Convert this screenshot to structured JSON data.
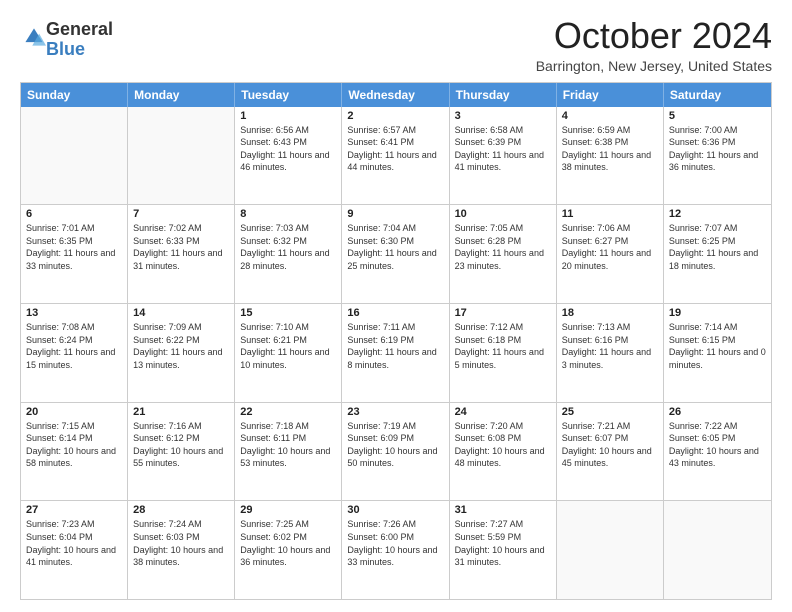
{
  "logo": {
    "general": "General",
    "blue": "Blue"
  },
  "title": "October 2024",
  "location": "Barrington, New Jersey, United States",
  "days": [
    "Sunday",
    "Monday",
    "Tuesday",
    "Wednesday",
    "Thursday",
    "Friday",
    "Saturday"
  ],
  "rows": [
    [
      {
        "num": "",
        "empty": true,
        "text": ""
      },
      {
        "num": "",
        "empty": true,
        "text": ""
      },
      {
        "num": "1",
        "text": "Sunrise: 6:56 AM\nSunset: 6:43 PM\nDaylight: 11 hours and 46 minutes."
      },
      {
        "num": "2",
        "text": "Sunrise: 6:57 AM\nSunset: 6:41 PM\nDaylight: 11 hours and 44 minutes."
      },
      {
        "num": "3",
        "text": "Sunrise: 6:58 AM\nSunset: 6:39 PM\nDaylight: 11 hours and 41 minutes."
      },
      {
        "num": "4",
        "text": "Sunrise: 6:59 AM\nSunset: 6:38 PM\nDaylight: 11 hours and 38 minutes."
      },
      {
        "num": "5",
        "text": "Sunrise: 7:00 AM\nSunset: 6:36 PM\nDaylight: 11 hours and 36 minutes."
      }
    ],
    [
      {
        "num": "6",
        "text": "Sunrise: 7:01 AM\nSunset: 6:35 PM\nDaylight: 11 hours and 33 minutes."
      },
      {
        "num": "7",
        "text": "Sunrise: 7:02 AM\nSunset: 6:33 PM\nDaylight: 11 hours and 31 minutes."
      },
      {
        "num": "8",
        "text": "Sunrise: 7:03 AM\nSunset: 6:32 PM\nDaylight: 11 hours and 28 minutes."
      },
      {
        "num": "9",
        "text": "Sunrise: 7:04 AM\nSunset: 6:30 PM\nDaylight: 11 hours and 25 minutes."
      },
      {
        "num": "10",
        "text": "Sunrise: 7:05 AM\nSunset: 6:28 PM\nDaylight: 11 hours and 23 minutes."
      },
      {
        "num": "11",
        "text": "Sunrise: 7:06 AM\nSunset: 6:27 PM\nDaylight: 11 hours and 20 minutes."
      },
      {
        "num": "12",
        "text": "Sunrise: 7:07 AM\nSunset: 6:25 PM\nDaylight: 11 hours and 18 minutes."
      }
    ],
    [
      {
        "num": "13",
        "text": "Sunrise: 7:08 AM\nSunset: 6:24 PM\nDaylight: 11 hours and 15 minutes."
      },
      {
        "num": "14",
        "text": "Sunrise: 7:09 AM\nSunset: 6:22 PM\nDaylight: 11 hours and 13 minutes."
      },
      {
        "num": "15",
        "text": "Sunrise: 7:10 AM\nSunset: 6:21 PM\nDaylight: 11 hours and 10 minutes."
      },
      {
        "num": "16",
        "text": "Sunrise: 7:11 AM\nSunset: 6:19 PM\nDaylight: 11 hours and 8 minutes."
      },
      {
        "num": "17",
        "text": "Sunrise: 7:12 AM\nSunset: 6:18 PM\nDaylight: 11 hours and 5 minutes."
      },
      {
        "num": "18",
        "text": "Sunrise: 7:13 AM\nSunset: 6:16 PM\nDaylight: 11 hours and 3 minutes."
      },
      {
        "num": "19",
        "text": "Sunrise: 7:14 AM\nSunset: 6:15 PM\nDaylight: 11 hours and 0 minutes."
      }
    ],
    [
      {
        "num": "20",
        "text": "Sunrise: 7:15 AM\nSunset: 6:14 PM\nDaylight: 10 hours and 58 minutes."
      },
      {
        "num": "21",
        "text": "Sunrise: 7:16 AM\nSunset: 6:12 PM\nDaylight: 10 hours and 55 minutes."
      },
      {
        "num": "22",
        "text": "Sunrise: 7:18 AM\nSunset: 6:11 PM\nDaylight: 10 hours and 53 minutes."
      },
      {
        "num": "23",
        "text": "Sunrise: 7:19 AM\nSunset: 6:09 PM\nDaylight: 10 hours and 50 minutes."
      },
      {
        "num": "24",
        "text": "Sunrise: 7:20 AM\nSunset: 6:08 PM\nDaylight: 10 hours and 48 minutes."
      },
      {
        "num": "25",
        "text": "Sunrise: 7:21 AM\nSunset: 6:07 PM\nDaylight: 10 hours and 45 minutes."
      },
      {
        "num": "26",
        "text": "Sunrise: 7:22 AM\nSunset: 6:05 PM\nDaylight: 10 hours and 43 minutes."
      }
    ],
    [
      {
        "num": "27",
        "text": "Sunrise: 7:23 AM\nSunset: 6:04 PM\nDaylight: 10 hours and 41 minutes."
      },
      {
        "num": "28",
        "text": "Sunrise: 7:24 AM\nSunset: 6:03 PM\nDaylight: 10 hours and 38 minutes."
      },
      {
        "num": "29",
        "text": "Sunrise: 7:25 AM\nSunset: 6:02 PM\nDaylight: 10 hours and 36 minutes."
      },
      {
        "num": "30",
        "text": "Sunrise: 7:26 AM\nSunset: 6:00 PM\nDaylight: 10 hours and 33 minutes."
      },
      {
        "num": "31",
        "text": "Sunrise: 7:27 AM\nSunset: 5:59 PM\nDaylight: 10 hours and 31 minutes."
      },
      {
        "num": "",
        "empty": true,
        "text": ""
      },
      {
        "num": "",
        "empty": true,
        "text": ""
      }
    ]
  ]
}
